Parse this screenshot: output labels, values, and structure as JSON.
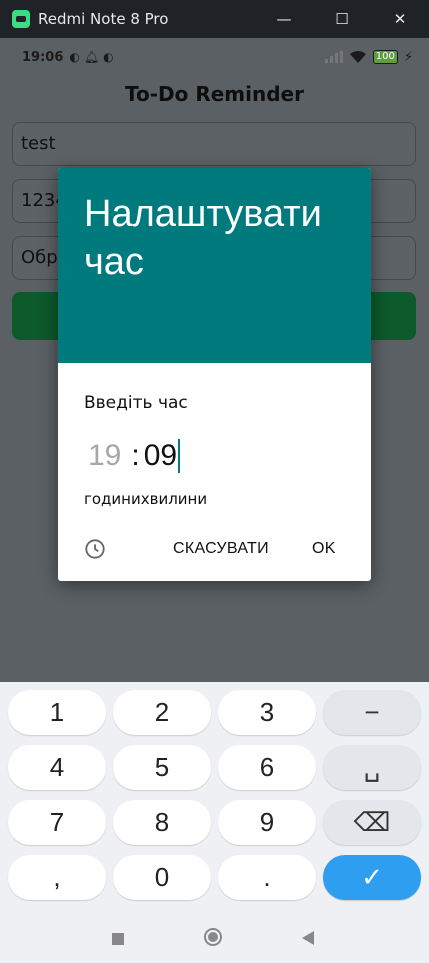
{
  "window": {
    "title": "Redmi Note 8 Pro",
    "minimize": "—",
    "maximize": "☐",
    "close": "✕"
  },
  "statusbar": {
    "time": "19:06",
    "battery": "100"
  },
  "app": {
    "title": "To-Do Reminder",
    "field1": "test",
    "field2": "1234",
    "field3": "Обр"
  },
  "dialog": {
    "header": "Налаштувати час",
    "subtitle": "Введіть час",
    "hour": "19",
    "separator": ":",
    "minute": "09",
    "hour_label": "години",
    "minute_label": "хвилини",
    "cancel": "СКАСУВАТИ",
    "ok": "OK"
  },
  "keyboard": {
    "keys": [
      "1",
      "2",
      "3",
      "−",
      "4",
      "5",
      "6",
      "␣",
      "7",
      "8",
      "9",
      "⌫",
      ",",
      "0",
      ".",
      "✓"
    ]
  }
}
